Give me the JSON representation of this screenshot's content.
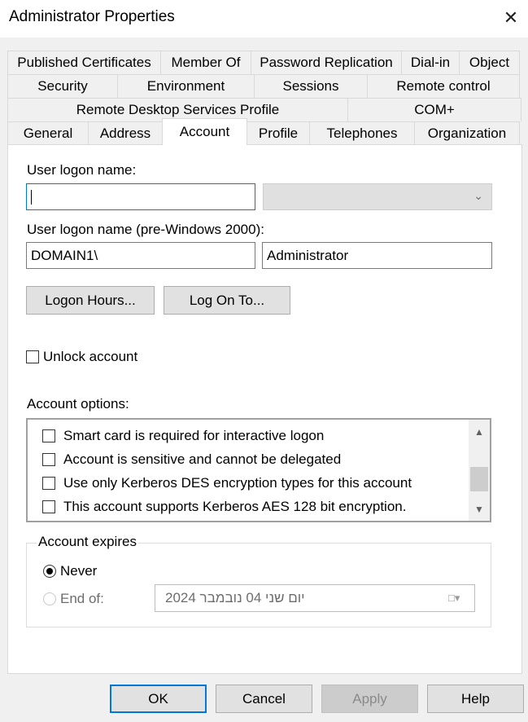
{
  "window": {
    "title": "Administrator Properties",
    "close_glyph": "✕"
  },
  "tabs": {
    "row1": [
      "Published Certificates",
      "Member Of",
      "Password Replication",
      "Dial-in",
      "Object"
    ],
    "row2": [
      "Security",
      "Environment",
      "Sessions",
      "Remote control"
    ],
    "row3": [
      "Remote Desktop Services Profile",
      "COM+"
    ],
    "row4": [
      "General",
      "Address",
      "Account",
      "Profile",
      "Telephones",
      "Organization"
    ],
    "active": "Account"
  },
  "account": {
    "logon_name_label": "User logon name:",
    "logon_name_value": "",
    "upn_suffix_value": "",
    "pre2000_label": "User logon name (pre-Windows 2000):",
    "pre2000_domain": "DOMAIN1\\",
    "pre2000_user": "Administrator",
    "logon_hours_button": "Logon Hours...",
    "log_on_to_button": "Log On To...",
    "unlock_label": "Unlock account",
    "unlock_checked": false,
    "options_label": "Account options:",
    "options": [
      {
        "label": "Smart card is required for interactive logon",
        "checked": false
      },
      {
        "label": "Account is sensitive and cannot be delegated",
        "checked": false
      },
      {
        "label": "Use only Kerberos DES encryption types for this account",
        "checked": false
      },
      {
        "label": "This account supports Kerberos AES 128 bit encryption.",
        "checked": false
      }
    ],
    "expires_label": "Account expires",
    "expires_never": "Never",
    "expires_end_of": "End of:",
    "expires_selected": "Never",
    "expires_date": "יום שני   04  נובמבר  2024"
  },
  "buttons": {
    "ok": "OK",
    "cancel": "Cancel",
    "apply": "Apply",
    "help": "Help"
  },
  "icons": {
    "dropdown": "chevron-down-icon",
    "scroll_up": "chevron-up-icon",
    "scroll_down": "chevron-down-icon",
    "calendar": "calendar-icon"
  },
  "colors": {
    "focus_border": "#0078d7",
    "dialog_bg": "#f0f0f0",
    "panel_bg": "#ffffff"
  }
}
